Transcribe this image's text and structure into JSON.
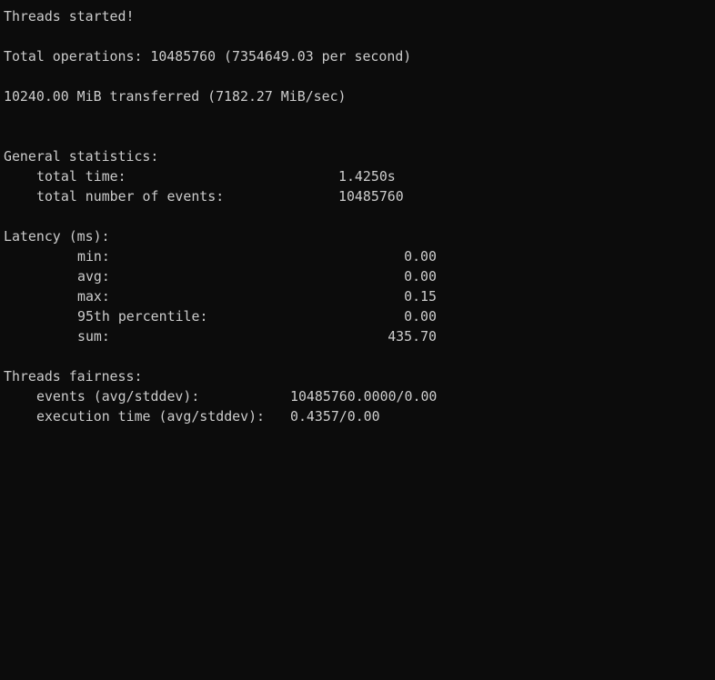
{
  "terminal": {
    "threads_started": "Threads started!",
    "total_operations": "Total operations: 10485760 (7354649.03 per second)",
    "transferred": "10240.00 MiB transferred (7182.27 MiB/sec)",
    "general": {
      "heading": "General statistics:",
      "total_time_label": "total time:",
      "total_time_value": "1.4250s",
      "total_events_label": "total number of events:",
      "total_events_value": "10485760"
    },
    "latency": {
      "heading": "Latency (ms):",
      "min_label": "min:",
      "min_value": "0.00",
      "avg_label": "avg:",
      "avg_value": "0.00",
      "max_label": "max:",
      "max_value": "0.15",
      "p95_label": "95th percentile:",
      "p95_value": "0.00",
      "sum_label": "sum:",
      "sum_value": "435.70"
    },
    "fairness": {
      "heading": "Threads fairness:",
      "events_label": "events (avg/stddev):",
      "events_value": "10485760.0000/0.00",
      "exec_label": "execution time (avg/stddev):",
      "exec_value": "0.4357/0.00"
    }
  }
}
